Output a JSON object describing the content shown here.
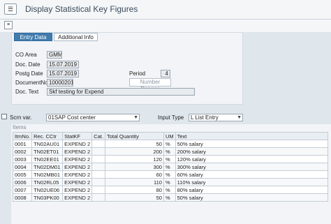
{
  "window": {
    "title": "Display Statistical Key Figures"
  },
  "tabs": [
    {
      "label": "Entry Data",
      "active": true
    },
    {
      "label": "Additional Info",
      "active": false
    }
  ],
  "header": {
    "co_area_label": "CO Area",
    "co_area_value": "GMM0",
    "doc_date_label": "Doc. Date",
    "doc_date_value": "15.07.2019",
    "postg_date_label": "Postg Date",
    "postg_date_value": "15.07.2019",
    "period_label": "Period",
    "period_value": "4",
    "document_no_label": "DocumentNo",
    "document_no_value": "10000201",
    "number_ranges_label": "Number Ranges",
    "doc_text_label": "Doc. Text",
    "doc_text_value": "Skf testing for Expend"
  },
  "variant": {
    "scrn_var_label": "Scrn var.",
    "scrn_var_value": "01SAP Cost center",
    "input_type_label": "Input Type",
    "input_type_value": "L List Entry"
  },
  "items": {
    "title": "Items",
    "columns": [
      "ItmNo.",
      "Rec. CCtr",
      "StatKF",
      "Cat.",
      "Total Quantity",
      "UM",
      "Text"
    ],
    "rows": [
      {
        "itm": "0001",
        "cctr": "TN02AU01",
        "statkf": "EXPEND 2",
        "cat": "",
        "qty": "50",
        "um": "%",
        "text": "50% salary"
      },
      {
        "itm": "0002",
        "cctr": "TN02ET01",
        "statkf": "EXPEND 2",
        "cat": "",
        "qty": "200",
        "um": "%",
        "text": "200% salary"
      },
      {
        "itm": "0003",
        "cctr": "TN02EE01",
        "statkf": "EXPEND 2",
        "cat": "",
        "qty": "120",
        "um": "%",
        "text": "120% salary"
      },
      {
        "itm": "0004",
        "cctr": "TN02DM01",
        "statkf": "EXPEND 2",
        "cat": "",
        "qty": "300",
        "um": "%",
        "text": "300% salary"
      },
      {
        "itm": "0005",
        "cctr": "TN02MB01",
        "statkf": "EXPEND 2",
        "cat": "",
        "qty": "60",
        "um": "%",
        "text": "60% salary"
      },
      {
        "itm": "0006",
        "cctr": "TN02RL05",
        "statkf": "EXPEND 2",
        "cat": "",
        "qty": "110",
        "um": "%",
        "text": "110% salary"
      },
      {
        "itm": "0007",
        "cctr": "TN02UE06",
        "statkf": "EXPEND 2",
        "cat": "",
        "qty": "80",
        "um": "%",
        "text": "80% salary"
      },
      {
        "itm": "0008",
        "cctr": "TN03PK00",
        "statkf": "EXPEND 2",
        "cat": "",
        "qty": "50",
        "um": "%",
        "text": "50% salary"
      }
    ]
  },
  "colors": {
    "active_tab": "#427cac",
    "background": "#dfe6ec"
  }
}
